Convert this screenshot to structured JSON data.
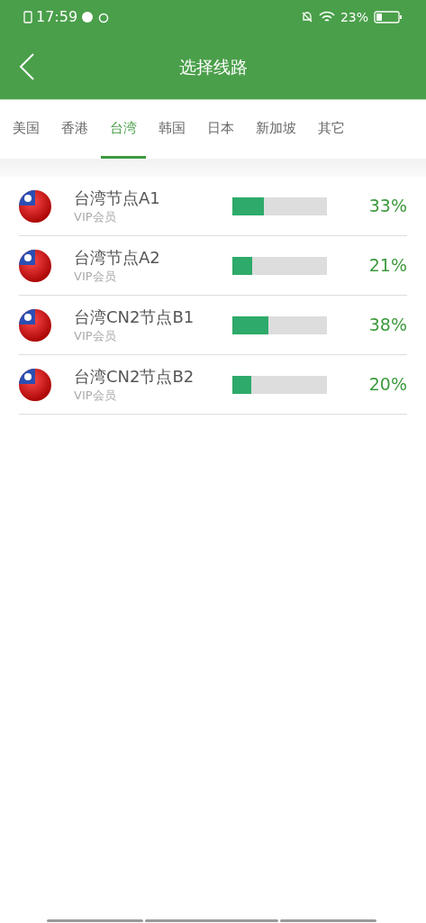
{
  "status_bar": {
    "time": "17:59",
    "battery": "23%"
  },
  "header": {
    "title": "选择线路"
  },
  "tabs": [
    {
      "label": "美国",
      "selected": false
    },
    {
      "label": "香港",
      "selected": false
    },
    {
      "label": "台湾",
      "selected": true
    },
    {
      "label": "韩国",
      "selected": false
    },
    {
      "label": "日本",
      "selected": false
    },
    {
      "label": "新加坡",
      "selected": false
    },
    {
      "label": "其它",
      "selected": false
    }
  ],
  "servers": [
    {
      "name": "台湾节点A1",
      "tier": "VIP会员",
      "level": 0.33,
      "reading": "33%"
    },
    {
      "name": "台湾节点A2",
      "tier": "VIP会员",
      "level": 0.21,
      "reading": "21%"
    },
    {
      "name": "台湾CN2节点B1",
      "tier": "VIP会员",
      "level": 0.38,
      "reading": "38%"
    },
    {
      "name": "台湾CN2节点B2",
      "tier": "VIP会员",
      "level": 0.2,
      "reading": "20%"
    }
  ]
}
